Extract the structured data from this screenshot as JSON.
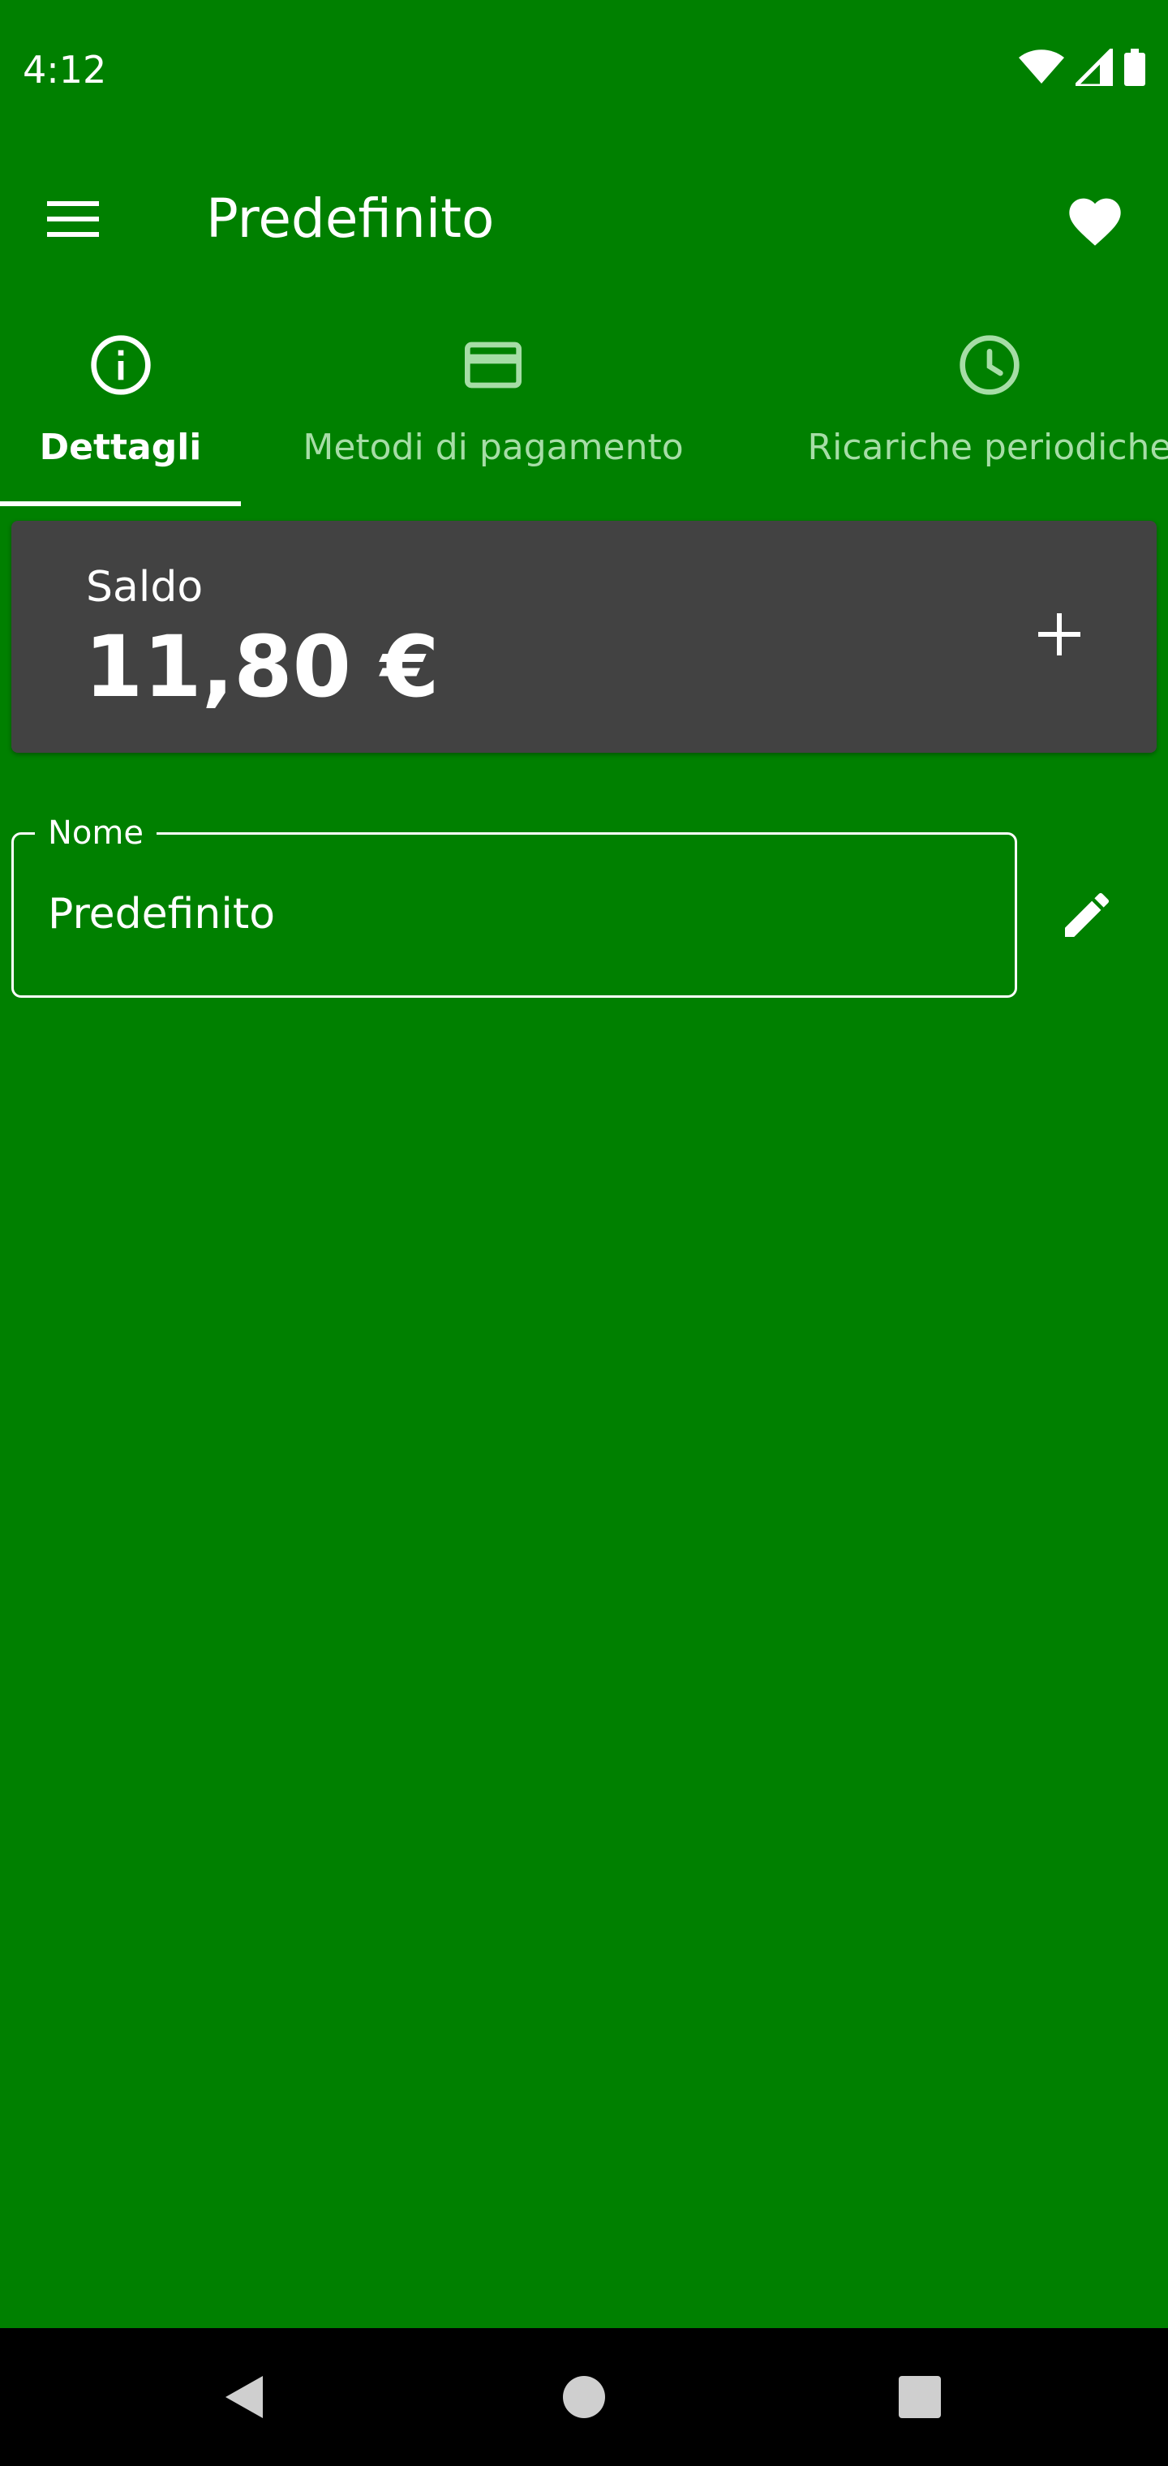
{
  "status_bar": {
    "time": "4:12",
    "icons": [
      "wifi-icon",
      "signal-icon",
      "battery-icon"
    ]
  },
  "app_bar": {
    "title": "Predefinito",
    "menu_icon": "menu-icon",
    "favorite_icon": "heart-icon"
  },
  "tabs": [
    {
      "label": "Dettagli",
      "icon": "info-icon",
      "active": true
    },
    {
      "label": "Metodi di pagamento",
      "icon": "credit-card-icon",
      "active": false
    },
    {
      "label": "Ricariche periodiche",
      "icon": "clock-icon",
      "active": false
    }
  ],
  "balance": {
    "label": "Saldo",
    "value": "11,80 €",
    "add_icon": "plus-icon"
  },
  "name_field": {
    "label": "Nome",
    "value": "Predefinito",
    "edit_icon": "pencil-icon"
  },
  "nav_bar": {
    "icons": [
      "back-icon",
      "home-icon",
      "recents-icon"
    ]
  },
  "colors": {
    "background": "#008000",
    "card": "#424242",
    "tab_inactive": "#a6dda6",
    "nav_bar": "#000000"
  }
}
